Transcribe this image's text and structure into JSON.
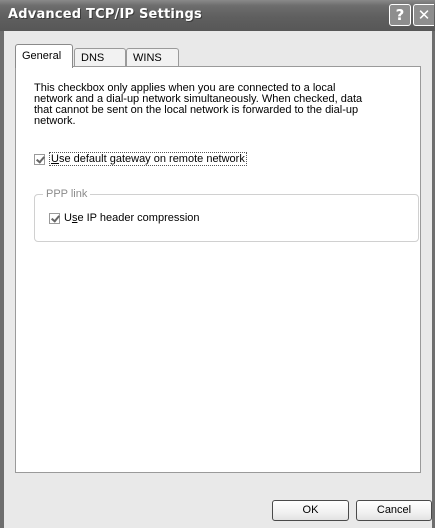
{
  "window": {
    "title": "Advanced TCP/IP Settings",
    "help_glyph": "?",
    "close_glyph": "✕"
  },
  "tabs": [
    {
      "label": "General",
      "active": true
    },
    {
      "label": "DNS",
      "active": false
    },
    {
      "label": "WINS",
      "active": false
    }
  ],
  "general": {
    "description_lines": [
      "This checkbox only applies when you are connected to a local",
      "network and a dial-up network simultaneously.  When checked, data",
      "that cannot be sent on the local network is forwarded to the dial-up",
      "network."
    ],
    "default_gateway": {
      "checked": true,
      "label_underlined": "U",
      "label_rest": "se default gateway on remote network"
    },
    "ppp_group": {
      "legend": "PPP link",
      "ip_header_compression": {
        "checked": true,
        "label_prefix": "U",
        "label_underlined": "s",
        "label_rest": "e IP header compression"
      }
    }
  },
  "buttons": {
    "ok": "OK",
    "cancel": "Cancel"
  }
}
